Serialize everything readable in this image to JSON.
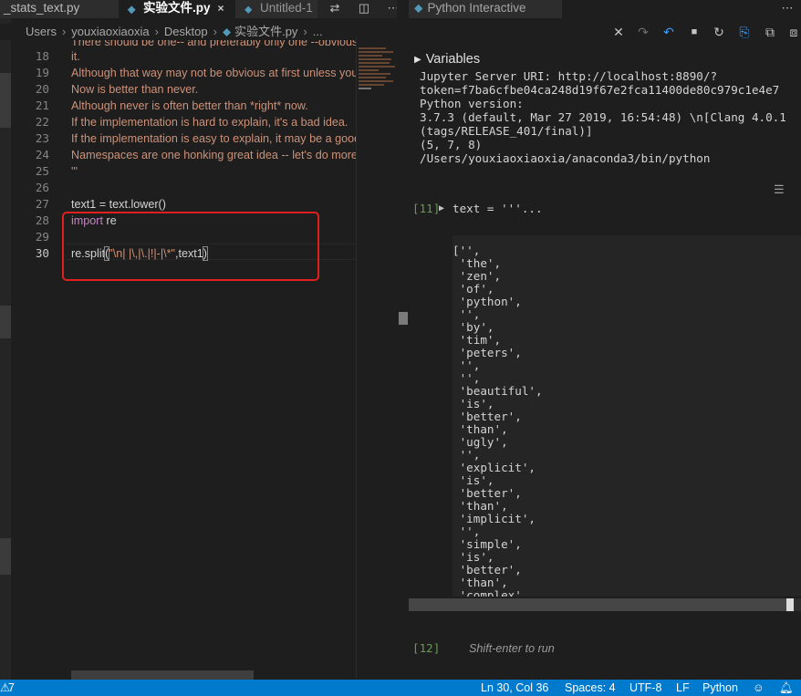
{
  "left_pane": {
    "tabs": [
      {
        "label": "_stats_text.py",
        "active": false
      },
      {
        "label": "实验文件.py",
        "active": true
      },
      {
        "label": "Untitled-1",
        "active": false
      }
    ],
    "tab_close": "×",
    "breadcrumb": [
      "Users",
      "youxiaoxiaoxia",
      "Desktop",
      "实验文件.py",
      "..."
    ],
    "top_partial_text": "There should be one-- and preferably only one --obvious way to do it.",
    "lines": [
      {
        "n": "18",
        "text": "it."
      },
      {
        "n": "19",
        "text": "Although that way may not be obvious at first unless you're Dutch."
      },
      {
        "n": "20",
        "text": "Now is better than never."
      },
      {
        "n": "21",
        "text": "Although never is often better than *right* now."
      },
      {
        "n": "22",
        "text": "If the implementation is hard to explain, it's a bad idea."
      },
      {
        "n": "23",
        "text": "If the implementation is easy to explain, it may be a good idea."
      },
      {
        "n": "24",
        "text": "Namespaces are one honking great idea -- let's do more of those!"
      },
      {
        "n": "25",
        "text": "'''"
      },
      {
        "n": "26",
        "text": ""
      },
      {
        "n": "27",
        "text": "text1 = text.lower()"
      },
      {
        "n": "28",
        "kw": "import",
        "rest": " re"
      },
      {
        "n": "29",
        "text": ""
      },
      {
        "n": "30",
        "pre": "re.split",
        "paren_open": "(",
        "str": "\"\\n| |\\,|\\.|!|-|\\*\"",
        "post": ",text1",
        "paren_close": ")"
      }
    ]
  },
  "right_pane": {
    "tab_label": "Python Interactive",
    "variables_label": "Variables",
    "info_lines": [
      "Jupyter Server URI: http://localhost:8890/?",
      "token=f7ba6cfbe04ca248d19f67e2fca11400de80c979c1e4e7",
      "Python version:",
      "3.7.3 (default, Mar 27 2019, 16:54:48) \\n[Clang 4.0.1",
      "(tags/RELEASE_401/final)]",
      "(5, 7, 8)",
      "/Users/youxiaoxiaoxia/anaconda3/bin/python"
    ],
    "cell_11": {
      "count": "[11]",
      "source": "text = '''..."
    },
    "output_lines": [
      "['',",
      " 'the',",
      " 'zen',",
      " 'of',",
      " 'python',",
      " '',",
      " 'by',",
      " 'tim',",
      " 'peters',",
      " '',",
      " '',",
      " 'beautiful',",
      " 'is',",
      " 'better',",
      " 'than',",
      " 'ugly',",
      " '',",
      " 'explicit',",
      " 'is',",
      " 'better',",
      " 'than',",
      " 'implicit',",
      " '',",
      " 'simple',",
      " 'is',",
      " 'better',",
      " 'than',",
      " 'complex',"
    ],
    "cell_12": {
      "count": "[12]",
      "hint": "Shift-enter to run"
    }
  },
  "status_bar": {
    "left": "7",
    "position": "Ln 30, Col 36",
    "spaces": "Spaces: 4",
    "encoding": "UTF-8",
    "eol": "LF",
    "language": "Python"
  },
  "colors": {
    "accent": "#007acc",
    "string": "#ce9178",
    "keyword": "#c586c0",
    "highlight_box": "#e01f1f"
  },
  "icons": {
    "python_file": "python-file-icon",
    "close": "close-icon",
    "split": "split-editor-icon",
    "more": "more-icon"
  }
}
